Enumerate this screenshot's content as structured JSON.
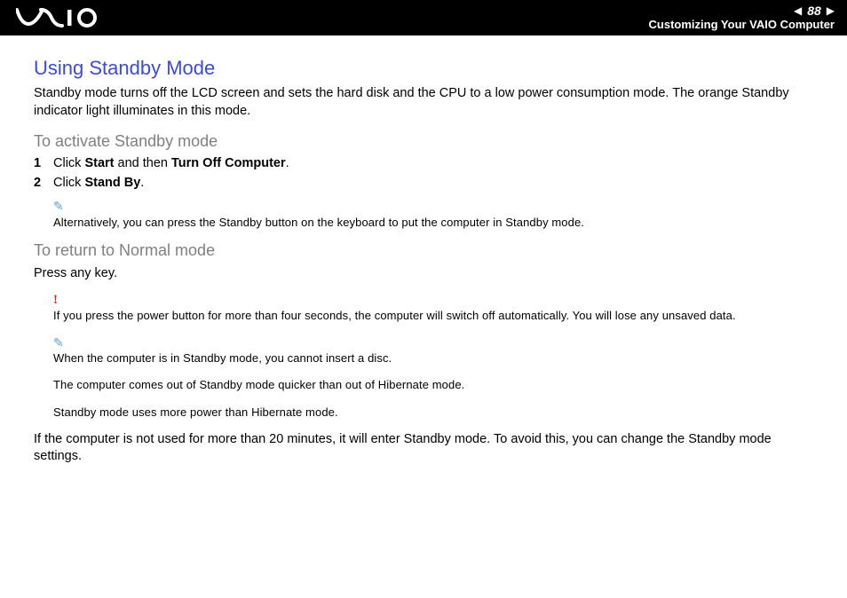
{
  "header": {
    "page_number": "88",
    "breadcrumb": "Customizing Your VAIO Computer"
  },
  "main": {
    "title": "Using Standby Mode",
    "intro": "Standby mode turns off the LCD screen and sets the hard disk and the CPU to a low power consumption mode. The orange Standby indicator light illuminates in this mode.",
    "section1": {
      "heading": "To activate Standby mode",
      "step1_num": "1",
      "step1_pre": "Click ",
      "step1_b1": "Start",
      "step1_mid": " and then ",
      "step1_b2": "Turn Off Computer",
      "step1_post": ".",
      "step2_num": "2",
      "step2_pre": "Click ",
      "step2_b1": "Stand By",
      "step2_post": ".",
      "note1": "Alternatively, you can press the Standby button on the keyboard to put the computer in Standby mode."
    },
    "section2": {
      "heading": "To return to Normal mode",
      "body": "Press any key.",
      "warn": "If you press the power button for more than four seconds, the computer will switch off automatically. You will lose any unsaved data.",
      "note_a": "When the computer is in Standby mode, you cannot insert a disc.",
      "note_b": "The computer comes out of Standby mode quicker than out of Hibernate mode.",
      "note_c": "Standby mode uses more power than Hibernate mode.",
      "footer": "If the computer is not used for more than 20 minutes, it will enter Standby mode. To avoid this, you can change the Standby mode settings."
    }
  }
}
